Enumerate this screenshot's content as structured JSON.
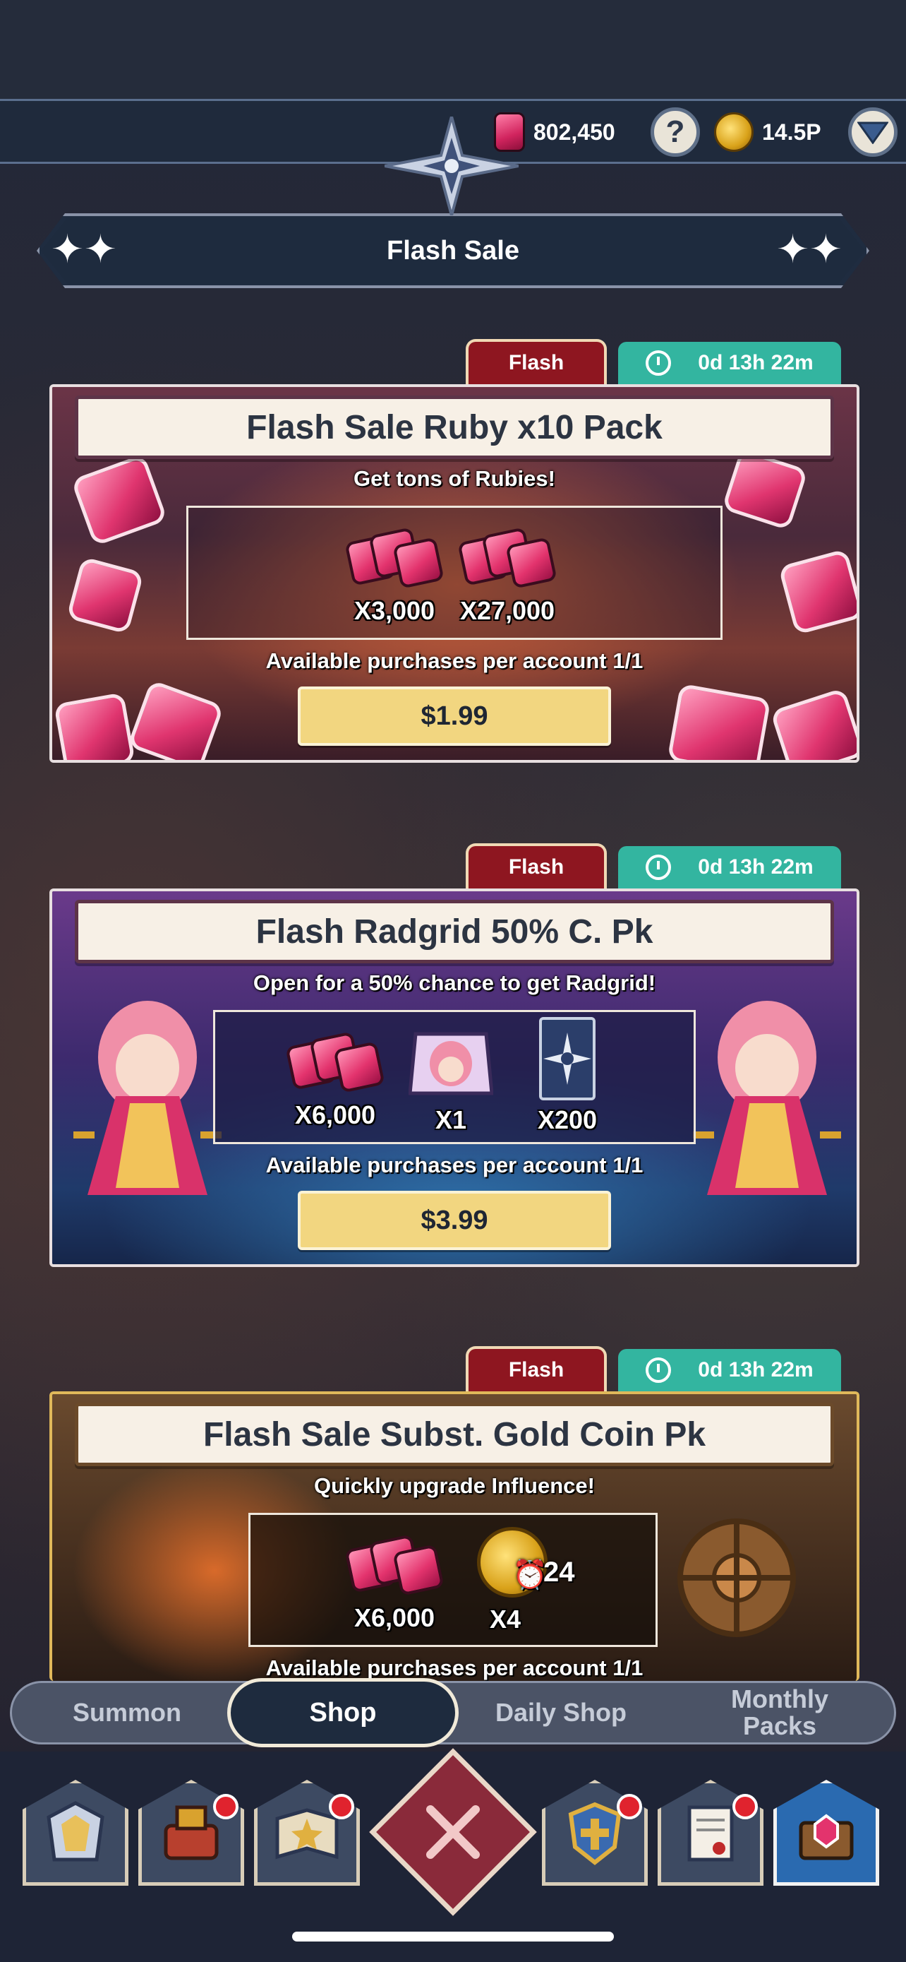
{
  "currency": {
    "ruby_amount": "802,450",
    "gold_amount": "14.5P",
    "help_symbol": "?"
  },
  "header": {
    "title": "Flash Sale"
  },
  "offers": [
    {
      "tag": "Flash",
      "timer": "0d 13h 22m",
      "title": "Flash Sale Ruby x10 Pack",
      "subtitle": "Get tons of Rubies!",
      "rewards": [
        "X3,000",
        "X27,000"
      ],
      "availability": "Available purchases per account 1/1",
      "price": "$1.99"
    },
    {
      "tag": "Flash",
      "timer": "0d 13h 22m",
      "title": "Flash Radgrid 50% C. Pk",
      "subtitle": "Open for a 50% chance to get Radgrid!",
      "rewards": [
        "X6,000",
        "X1",
        "X200"
      ],
      "availability": "Available purchases per account 1/1",
      "price": "$3.99"
    },
    {
      "tag": "Flash",
      "timer": "0d 13h 22m",
      "title": "Flash Sale Subst. Gold Coin Pk",
      "subtitle": "Quickly upgrade Influence!",
      "rewards": [
        "X6,000",
        "X4"
      ],
      "coin_duration": "24",
      "availability": "Available purchases per account 1/1"
    }
  ],
  "tabs": {
    "summon": "Summon",
    "shop": "Shop",
    "daily_shop": "Daily Shop",
    "monthly_packs_line1": "Monthly",
    "monthly_packs_line2": "Packs"
  },
  "nav": {
    "icons": [
      "armor-icon",
      "forge-icon",
      "book-icon",
      "close-icon",
      "guild-shield-icon",
      "scroll-icon",
      "shop-chest-icon"
    ]
  },
  "colors": {
    "flash_tag": "#8e1620",
    "timer_tag": "#33b5a0",
    "price_button": "#f2d680",
    "notification_badge": "#e0232e"
  }
}
